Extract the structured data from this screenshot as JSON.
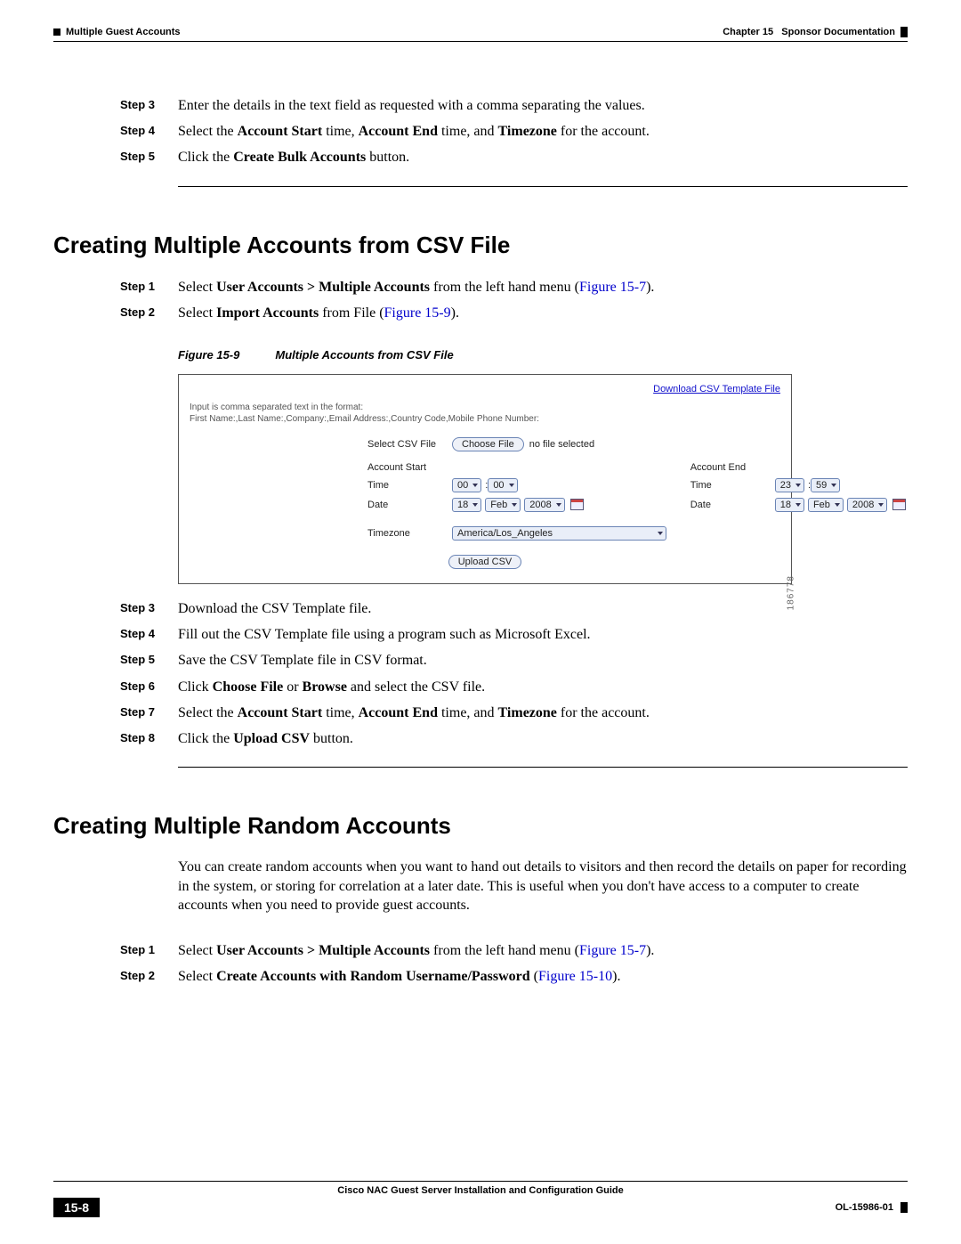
{
  "header": {
    "chapter_label": "Chapter 15",
    "chapter_title": "Sponsor Documentation",
    "section_title": "Multiple Guest Accounts"
  },
  "topsteps": {
    "s3": {
      "label": "Step 3",
      "text_before": "Enter the details in the text field as requested with a comma separating the values."
    },
    "s4": {
      "label": "Step 4",
      "t1": "Select the ",
      "b1": "Account Start",
      "t2": " time, ",
      "b2": "Account End",
      "t3": " time, and ",
      "b3": "Timezone",
      "t4": " for the account."
    },
    "s5": {
      "label": "Step 5",
      "t1": "Click the ",
      "b1": "Create Bulk Accounts",
      "t2": " button."
    }
  },
  "sec_csv": {
    "heading": "Creating Multiple Accounts from CSV File",
    "s1": {
      "label": "Step 1",
      "t1": "Select ",
      "b1": "User Accounts > Multiple Accounts",
      "t2": " from the left hand menu (",
      "link": "Figure 15-7",
      "t3": ")."
    },
    "s2": {
      "label": "Step 2",
      "t1": "Select ",
      "b1": "Import Accounts",
      "t2": " from File (",
      "link": "Figure 15-9",
      "t3": ")."
    },
    "fig": {
      "caption_label": "Figure 15-9",
      "caption_text": "Multiple Accounts from CSV File",
      "download_link": "Download CSV Template File",
      "hint1": "Input is comma separated text in the format:",
      "hint2": "First Name:,Last Name:,Company:,Email Address:,Country Code,Mobile Phone Number:",
      "select_csv_label": "Select CSV File",
      "choose_file_btn": "Choose File",
      "no_file": "no file selected",
      "acct_start": "Account Start",
      "acct_end": "Account End",
      "time_label": "Time",
      "date_label": "Date",
      "start_hh": "00",
      "start_mm": "00",
      "end_hh": "23",
      "end_mm": "59",
      "start_d": "18",
      "start_mo": "Feb",
      "start_y": "2008",
      "end_d": "18",
      "end_mo": "Feb",
      "end_y": "2008",
      "tz_label": "Timezone",
      "tz_value": "America/Los_Angeles",
      "upload_btn": "Upload CSV",
      "side_no": "186778"
    },
    "s3": {
      "label": "Step 3",
      "text": "Download the CSV Template file."
    },
    "s4": {
      "label": "Step 4",
      "text": "Fill out the CSV Template file using a program such as Microsoft Excel."
    },
    "s5": {
      "label": "Step 5",
      "text": "Save the CSV Template file in CSV format."
    },
    "s6": {
      "label": "Step 6",
      "t1": "Click ",
      "b1": "Choose File",
      "t2": " or ",
      "b2": "Browse",
      "t3": " and select the CSV file."
    },
    "s7": {
      "label": "Step 7",
      "t1": "Select the ",
      "b1": "Account Start",
      "t2": " time, ",
      "b2": "Account End",
      "t3": " time, and ",
      "b3": "Timezone",
      "t4": " for the account."
    },
    "s8": {
      "label": "Step 8",
      "t1": "Click the ",
      "b1": "Upload CSV",
      "t2": " button."
    }
  },
  "sec_random": {
    "heading": "Creating Multiple Random Accounts",
    "para": "You can create random accounts when you want to hand out details to visitors and then record the details on paper for recording in the system, or storing for correlation at a later date. This is useful when you don't have access to a computer to create accounts when you need to provide guest accounts.",
    "s1": {
      "label": "Step 1",
      "t1": "Select ",
      "b1": "User Accounts > Multiple Accounts",
      "t2": " from the left hand menu (",
      "link": "Figure 15-7",
      "t3": ")."
    },
    "s2": {
      "label": "Step 2",
      "t1": "Select ",
      "b1": "Create Accounts with Random Username/Password",
      "t2": " (",
      "link": "Figure 15-10",
      "t3": ")."
    }
  },
  "footer": {
    "guide_title": "Cisco NAC Guest Server Installation and Configuration Guide",
    "page_no": "15-8",
    "doc_code": "OL-15986-01"
  }
}
